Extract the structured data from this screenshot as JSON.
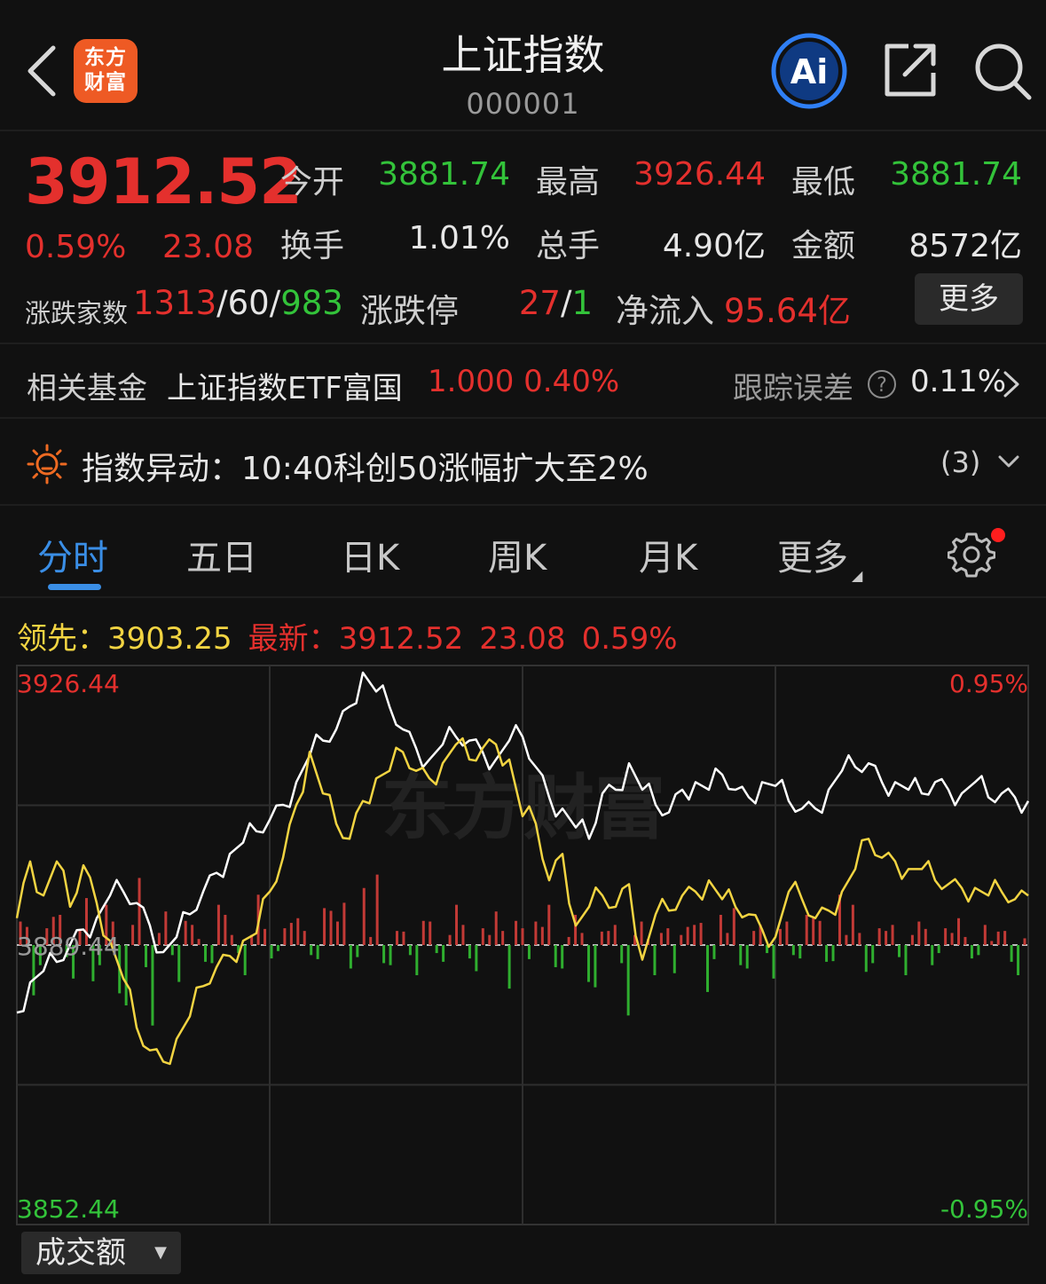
{
  "header": {
    "logo_text": "东方财富",
    "title": "上证指数",
    "code": "000001",
    "ai_label": "Ai"
  },
  "quote": {
    "price": "3912.52",
    "change_pct": "0.59%",
    "change": "23.08",
    "open_label": "今开",
    "open": "3881.74",
    "high_label": "最高",
    "high": "3926.44",
    "low_label": "最低",
    "low": "3881.74",
    "turnover_label": "换手",
    "turnover": "1.01%",
    "volume_label": "总手",
    "volume": "4.90亿",
    "amount_label": "金额",
    "amount": "8572亿",
    "breadth_label": "涨跌家数",
    "up_count": "1313",
    "flat_count": "60",
    "down_count": "983",
    "limit_label": "涨跌停",
    "limit_up": "27",
    "limit_down": "1",
    "inflow_label": "净流入",
    "inflow": "95.64亿",
    "more_label": "更多"
  },
  "fund": {
    "label": "相关基金",
    "name": "上证指数ETF富国",
    "price": "1.000",
    "pct": "0.40%",
    "tracking_label": "跟踪误差",
    "tracking_value": "0.11%"
  },
  "alert": {
    "text": "指数异动：10:40科创50涨幅扩大至2%",
    "count": "(3)"
  },
  "tabs": [
    {
      "label": "分时"
    },
    {
      "label": "五日"
    },
    {
      "label": "日K"
    },
    {
      "label": "周K"
    },
    {
      "label": "月K"
    },
    {
      "label": "更多"
    }
  ],
  "info": {
    "lead_label": "领先：",
    "lead_value": "3903.25",
    "latest_label": "最新：",
    "latest_value": "3912.52",
    "latest_change": "23.08",
    "latest_pct": "0.59%"
  },
  "chart_data": {
    "type": "line",
    "title": "",
    "watermark": "东方财富",
    "y_max_label": "3926.44",
    "y_mid_label": "3889.44",
    "y_min_label": "3852.44",
    "pct_max_label": "0.95%",
    "pct_min_label": "-0.95%",
    "ylim": [
      3852.44,
      3926.44
    ],
    "base": 3889.44,
    "series": [
      {
        "name": "最新",
        "color": "#ffffff",
        "values": [
          3880.5,
          3884.5,
          3886.0,
          3887.2,
          3889.5,
          3891.5,
          3893.0,
          3896.0,
          3896.5,
          3895.0,
          3892.0,
          3888.5,
          3890.5,
          3893.5,
          3896.5,
          3899.0,
          3901.5,
          3903.0,
          3904.5,
          3906.0,
          3908.0,
          3911.0,
          3914.5,
          3916.5,
          3918.0,
          3921.0,
          3925.5,
          3923.0,
          3921.0,
          3918.0,
          3915.5,
          3914.0,
          3916.0,
          3917.0,
          3916.5,
          3915.0,
          3914.0,
          3916.5,
          3917.0,
          3913.0,
          3909.0,
          3907.5,
          3905.0,
          3903.5,
          3909.5,
          3910.0,
          3913.5,
          3910.0,
          3908.0,
          3907.0,
          3910.0,
          3911.0,
          3910.0,
          3912.0,
          3910.0,
          3909.0,
          3911.0,
          3910.5,
          3908.5,
          3907.5,
          3907.5,
          3910.0,
          3912.5,
          3913.0,
          3913.5,
          3911.0,
          3911.0,
          3910.0,
          3909.5,
          3911.0,
          3910.0,
          3909.5,
          3911.0,
          3909.0,
          3909.5,
          3909.0,
          3908.5
        ]
      },
      {
        "name": "领先",
        "color": "#f2d442",
        "values": [
          3893.0,
          3900.5,
          3896.0,
          3900.5,
          3894.5,
          3900.0,
          3895.0,
          3890.0,
          3885.0,
          3878.5,
          3875.5,
          3874.0,
          3877.0,
          3880.0,
          3884.0,
          3886.5,
          3888.0,
          3890.0,
          3891.0,
          3896.5,
          3901.0,
          3908.0,
          3915.0,
          3909.5,
          3905.5,
          3903.5,
          3908.5,
          3911.5,
          3912.5,
          3915.0,
          3912.5,
          3911.5,
          3913.5,
          3916.0,
          3914.0,
          3915.5,
          3916.0,
          3914.0,
          3906.5,
          3905.5,
          3898.0,
          3901.5,
          3892.0,
          3894.5,
          3896.0,
          3894.5,
          3897.5,
          3887.5,
          3893.5,
          3894.0,
          3896.0,
          3896.5,
          3898.0,
          3895.5,
          3894.5,
          3893.5,
          3891.5,
          3890.5,
          3896.5,
          3895.5,
          3893.0,
          3894.0,
          3896.5,
          3899.5,
          3903.5,
          3901.0,
          3900.5,
          3899.5,
          3899.5,
          3898.0,
          3897.5,
          3897.0,
          3897.0,
          3896.0,
          3896.5,
          3895.5,
          3896.0
        ]
      }
    ],
    "volume_max": 60,
    "volume": [
      14,
      -30,
      10,
      18,
      -20,
      28,
      -12,
      14,
      -36,
      40,
      -48,
      20,
      -22,
      12,
      -10,
      24,
      6,
      -18,
      30,
      -8,
      10,
      16,
      -6,
      22,
      14,
      -14,
      34,
      42,
      -12,
      8,
      -18,
      14,
      -10,
      24,
      -8,
      10,
      20,
      -26,
      10,
      14,
      24,
      -14,
      18,
      -22,
      8,
      12,
      -42,
      14,
      -18,
      10,
      6,
      12,
      -28,
      18,
      22,
      -14,
      12,
      -20,
      14,
      -8,
      16,
      -10,
      30,
      24,
      -16,
      10,
      12,
      -18,
      14,
      -12,
      10,
      16,
      -8,
      12,
      8,
      -10,
      4
    ]
  },
  "volume_selector": {
    "label": "成交额"
  }
}
